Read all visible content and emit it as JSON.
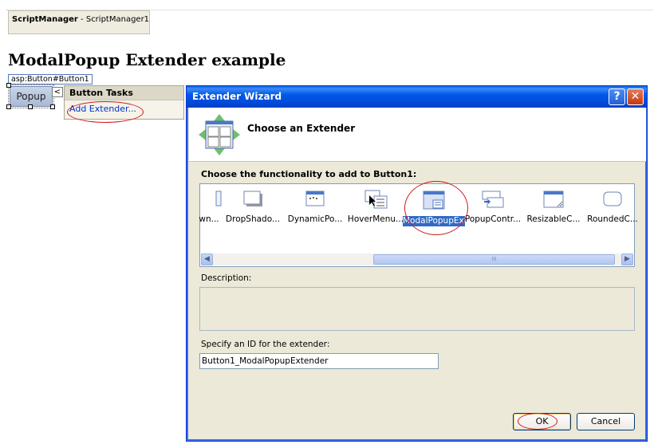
{
  "designer": {
    "script_manager_type": "ScriptManager",
    "script_manager_name": " - ScriptManager1",
    "page_heading": "ModalPopup Extender example",
    "control_tag": "asp:Button#Button1",
    "popup_button_label": "Popup",
    "smart_tag_glyph": "<",
    "tasks_panel": {
      "title": "Button Tasks",
      "add_extender_link": "Add Extender..."
    }
  },
  "dialog": {
    "title": "Extender Wizard",
    "help_glyph": "?",
    "close_glyph": "✕",
    "header_title": "Choose an Extender",
    "choose_label": "Choose the functionality to add to Button1:",
    "extenders": [
      {
        "label": "wn...",
        "icon": "partial-extender-icon"
      },
      {
        "label": "DropShado...",
        "icon": "dropshadow-extender-icon"
      },
      {
        "label": "DynamicPo...",
        "icon": "dynamicpopulate-extender-icon"
      },
      {
        "label": "HoverMenu...",
        "icon": "hovermenu-extender-icon"
      },
      {
        "label": "ModalPopupExtender",
        "icon": "modalpopup-extender-icon",
        "selected": true
      },
      {
        "label": "PopupContr...",
        "icon": "popupcontrol-extender-icon"
      },
      {
        "label": "ResizableC...",
        "icon": "resizablecontrol-extender-icon"
      },
      {
        "label": "RoundedC...",
        "icon": "roundedcorners-extender-icon"
      }
    ],
    "scroll_thumb_grip": "III",
    "description_label": "Description:",
    "id_label": "Specify an ID for the extender:",
    "id_value": "Button1_ModalPopupExtender",
    "ok_label": "OK",
    "cancel_label": "Cancel"
  },
  "colors": {
    "annotation_red": "#d01818",
    "selection_blue": "#316ac5",
    "titlebar_blue": "#0058e6"
  }
}
